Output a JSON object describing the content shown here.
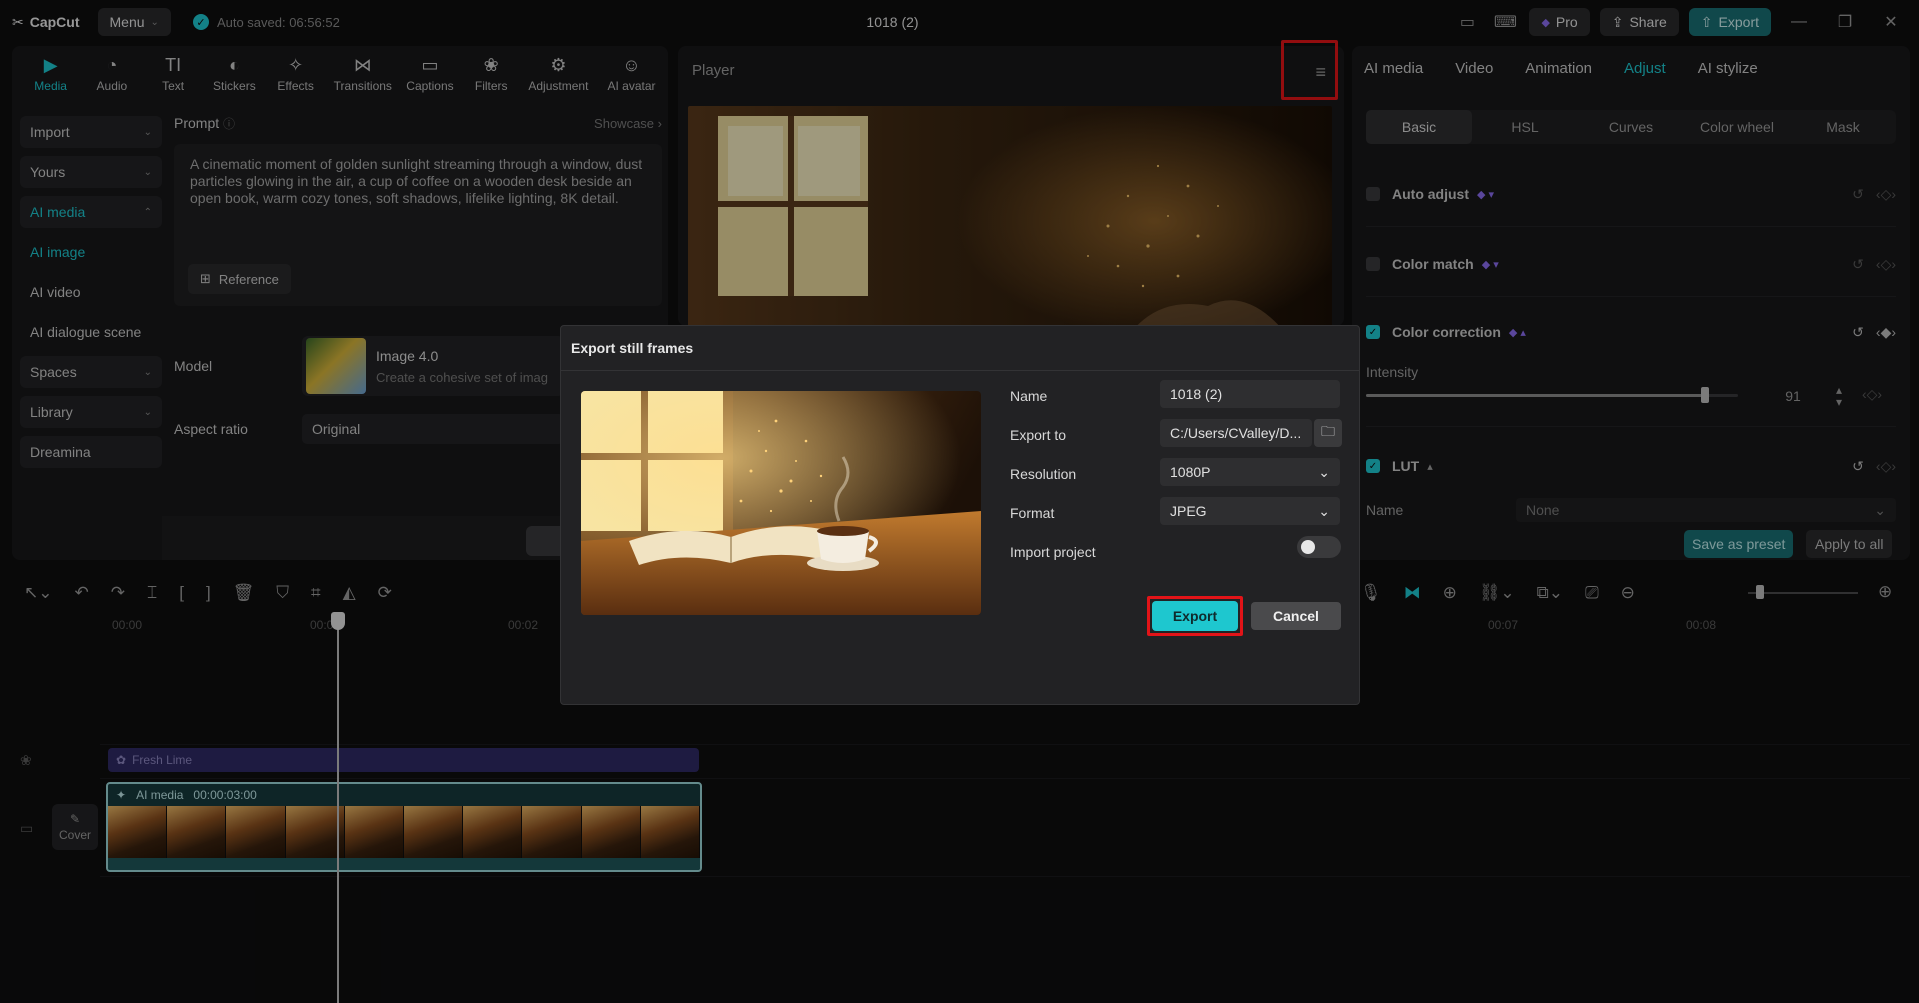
{
  "app": {
    "logo": "CapCut",
    "menu_label": "Menu",
    "autosave": "Auto saved: 06:56:52",
    "title": "1018 (2)"
  },
  "titlebar": {
    "pro_label": "Pro",
    "share_label": "Share",
    "export_label": "Export"
  },
  "tools": [
    {
      "label": "Media",
      "icon": "▶"
    },
    {
      "label": "Audio",
      "icon": "◔"
    },
    {
      "label": "Text",
      "icon": "TI"
    },
    {
      "label": "Stickers",
      "icon": "◐"
    },
    {
      "label": "Effects",
      "icon": "✧"
    },
    {
      "label": "Transitions",
      "icon": "⋈"
    },
    {
      "label": "Captions",
      "icon": "▭"
    },
    {
      "label": "Filters",
      "icon": "❀"
    },
    {
      "label": "Adjustment",
      "icon": "⚙"
    },
    {
      "label": "AI avatar",
      "icon": "☺"
    }
  ],
  "sidebar": {
    "import": "Import",
    "yours": "Yours",
    "ai_media": "AI media",
    "ai_image": "AI image",
    "ai_video": "AI video",
    "ai_dialogue": "AI dialogue scene",
    "spaces": "Spaces",
    "library": "Library",
    "dreamina": "Dreamina"
  },
  "prompt": {
    "label": "Prompt",
    "showcase": "Showcase",
    "text": "A cinematic moment of golden sunlight streaming through a window, dust particles glowing in the air, a cup of coffee on a wooden desk beside an open book, warm cozy tones, soft shadows, lifelike lighting, 8K detail.",
    "reference": "Reference"
  },
  "model": {
    "label": "Model",
    "name": "Image 4.0",
    "desc": "Create a cohesive set of imag"
  },
  "aspect": {
    "label": "Aspect ratio",
    "value": "Original"
  },
  "player": {
    "title": "Player"
  },
  "right_panel": {
    "tabs": [
      "AI media",
      "Video",
      "Animation",
      "Adjust",
      "AI stylize"
    ],
    "segments": [
      "Basic",
      "HSL",
      "Curves",
      "Color wheel",
      "Mask"
    ],
    "auto_adjust": "Auto adjust",
    "color_match": "Color match",
    "color_correction": "Color correction",
    "intensity_label": "Intensity",
    "intensity_value": "91",
    "intensity_level": 91,
    "lut": "LUT",
    "lut_name_label": "Name",
    "lut_name_value": "None",
    "save_preset": "Save as preset",
    "apply_all": "Apply to all"
  },
  "timeline": {
    "ticks": [
      "00:00",
      "00:01",
      "00:02",
      "00:07",
      "00:08"
    ],
    "effect_clip": "Fresh Lime",
    "video_clip_name": "AI media",
    "video_clip_duration": "00:00:03:00",
    "cover": "Cover"
  },
  "dialog": {
    "title": "Export still frames",
    "name_label": "Name",
    "name_value": "1018 (2)",
    "export_to_label": "Export to",
    "export_to_value": "C:/Users/CValley/D...",
    "resolution_label": "Resolution",
    "resolution_value": "1080P",
    "format_label": "Format",
    "format_value": "JPEG",
    "import_label": "Import project",
    "export_btn": "Export",
    "cancel_btn": "Cancel"
  },
  "colors": {
    "accent": "#1ec7cf",
    "highlight": "#e21418"
  }
}
